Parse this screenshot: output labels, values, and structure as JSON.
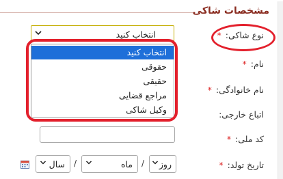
{
  "section": {
    "title": "مشخصات شاکی"
  },
  "fields": {
    "complainant_type": {
      "label": "نوع شاکی:",
      "required": "*",
      "value": "انتخاب کنید"
    },
    "first_name": {
      "label": "نام:",
      "required": "*"
    },
    "last_name": {
      "label": "نام خانوادگی:",
      "required": "*"
    },
    "foreign_national": {
      "label": "اتباع خارجی:"
    },
    "national_code": {
      "label": "کد ملی:",
      "required": "*",
      "value": ""
    },
    "birth_date": {
      "label": "تاریخ تولد:",
      "required": "*",
      "day_placeholder": "روز",
      "month_placeholder": "ماه",
      "year_placeholder": "سال",
      "separator": "/"
    }
  },
  "dropdown": {
    "options": [
      "انتخاب کنید",
      "حقوقی",
      "حقیقی",
      "مراجع قضایی",
      "وکیل شاکی"
    ],
    "selected_index": 0
  },
  "colors": {
    "title": "#8b2e22",
    "required": "#dd2222",
    "highlight": "#e3202c",
    "selected_bg": "#1e6fd9"
  },
  "icons": {
    "calendar": "calendar-icon",
    "chevron": "chevron-down-icon"
  }
}
